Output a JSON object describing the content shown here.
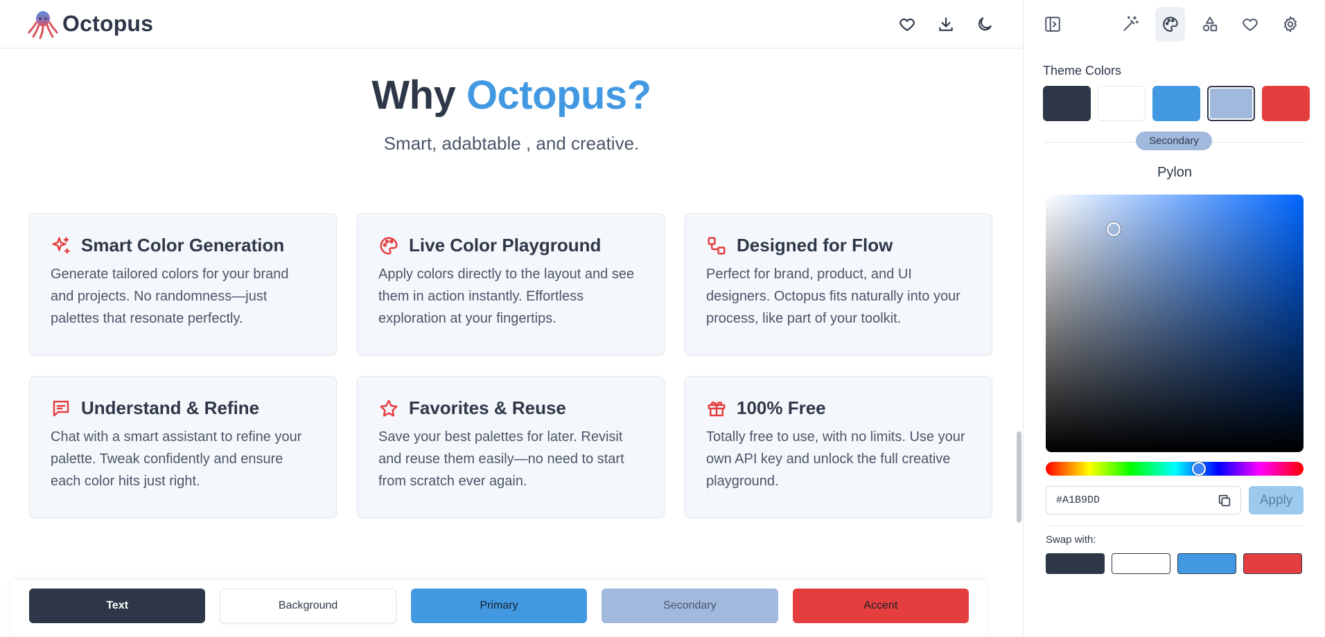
{
  "header": {
    "logo_text": "Octopus",
    "actions": [
      {
        "name": "favorites",
        "icon": "heart-icon"
      },
      {
        "name": "download",
        "icon": "download-icon"
      },
      {
        "name": "dark-mode",
        "icon": "moon-icon"
      }
    ]
  },
  "hero": {
    "title_prefix": "Why ",
    "title_accent": "Octopus?",
    "subtitle": "Smart, adabtable , and creative."
  },
  "features": [
    {
      "icon": "sparkles-icon",
      "title": "Smart Color Generation",
      "body": "Generate tailored colors for your brand and projects. No randomness—just palettes that resonate perfectly."
    },
    {
      "icon": "palette-icon",
      "title": "Live Color Playground",
      "body": "Apply colors directly to the layout and see them in action instantly. Effortless exploration at your fingertips."
    },
    {
      "icon": "flow-icon",
      "title": "Designed for Flow",
      "body": "Perfect for brand, product, and UI designers. Octopus fits naturally into your process, like part of your toolkit."
    },
    {
      "icon": "chat-icon",
      "title": "Understand & Refine",
      "body": "Chat with a smart assistant to refine your palette. Tweak confidently and ensure each color hits just right."
    },
    {
      "icon": "star-icon",
      "title": "Favorites & Reuse",
      "body": "Save your best palettes for later. Revisit and reuse them easily—no need to start from scratch ever again."
    },
    {
      "icon": "gift-icon",
      "title": "100% Free",
      "body": "Totally free to use, with no limits. Use your own API key and unlock the full creative playground."
    }
  ],
  "palette_bar": {
    "text": "Text",
    "background": "Background",
    "primary": "Primary",
    "secondary": "Secondary",
    "accent": "Accent"
  },
  "colors": {
    "text": "#2D3748",
    "background": "#FFFFFF",
    "primary": "#4299E1",
    "secondary": "#A1B9DD",
    "accent": "#E53E3E"
  },
  "panel": {
    "toolbar": [
      {
        "name": "collapse-panel",
        "icon": "panel-collapse-icon"
      },
      {
        "name": "generate",
        "icon": "magic-wand-icon"
      },
      {
        "name": "theme",
        "icon": "palette-icon",
        "active": true
      },
      {
        "name": "shapes",
        "icon": "shapes-icon"
      },
      {
        "name": "favorites",
        "icon": "heart-icon"
      },
      {
        "name": "settings",
        "icon": "gear-icon"
      }
    ],
    "theme_colors_label": "Theme Colors",
    "selected_badge": "Secondary",
    "color_name": "Pylon",
    "hex_value": "#A1B9DD",
    "apply_label": "Apply",
    "swap_label": "Swap with:"
  }
}
